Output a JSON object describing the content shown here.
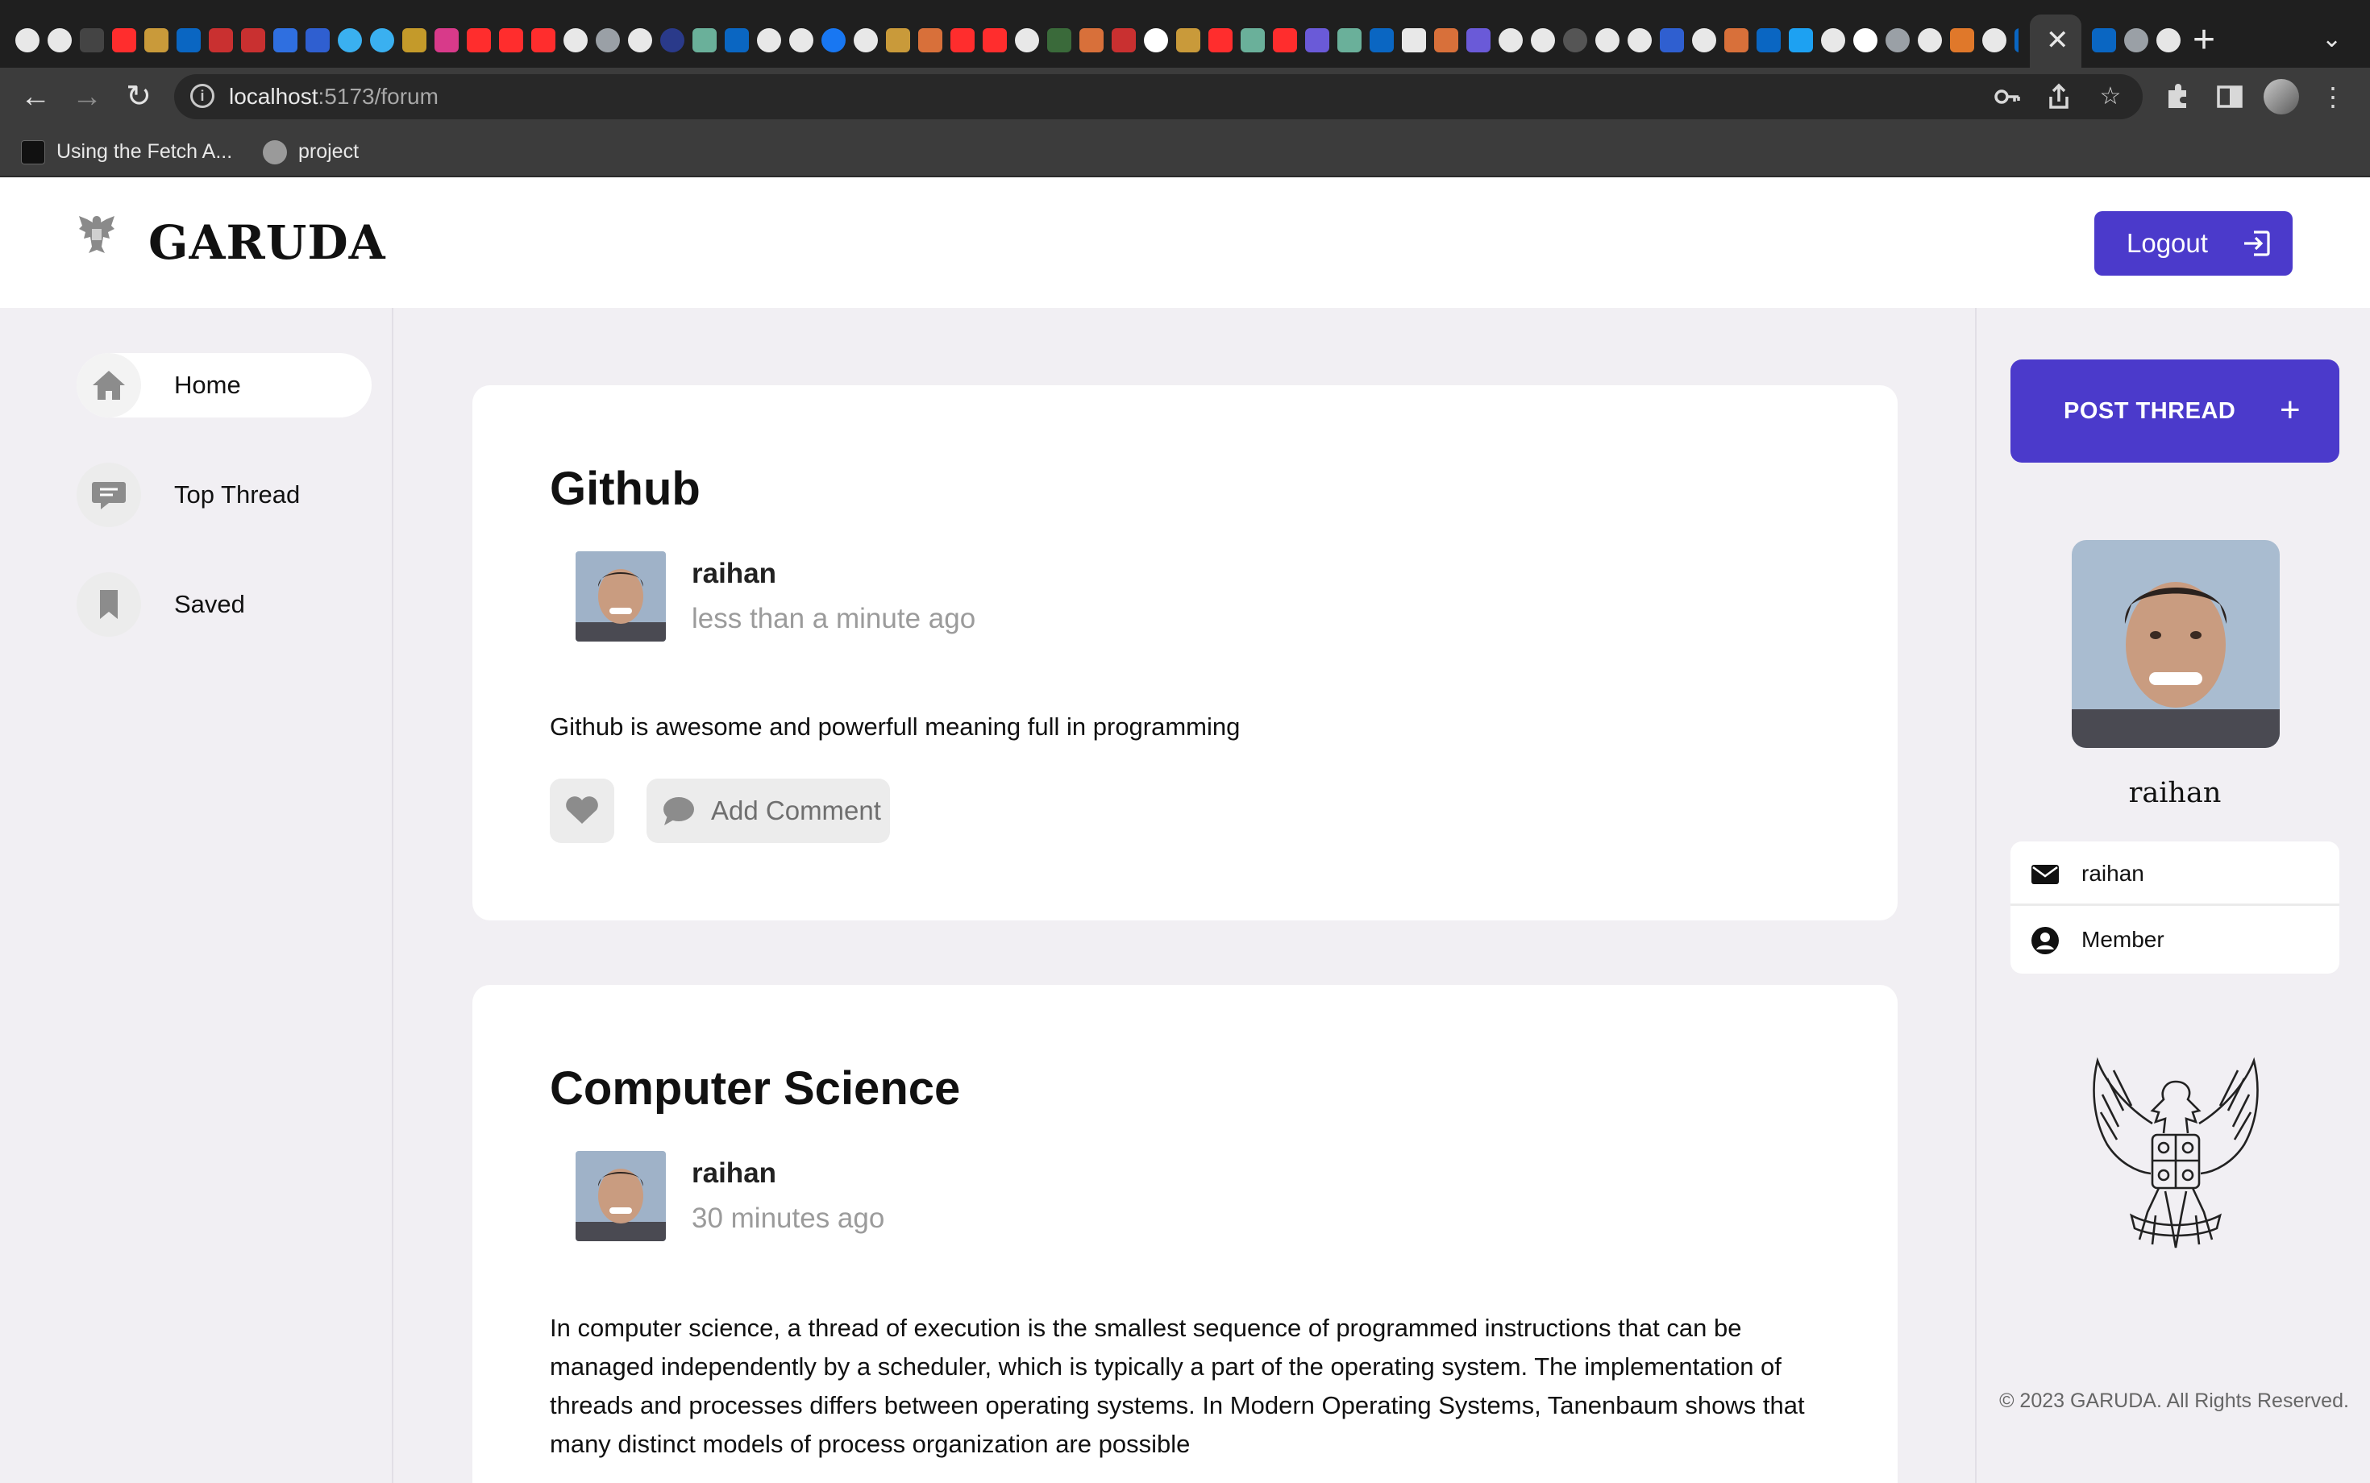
{
  "browser": {
    "url_host": "localhost",
    "url_path": ":5173/forum",
    "bookmarks": [
      {
        "label": "Using the Fetch A...",
        "icon": "mdn-icon"
      },
      {
        "label": "project",
        "icon": "globe-icon"
      }
    ],
    "active_tab_close": "✕",
    "new_tab": "+",
    "tab_menu": "⌄"
  },
  "app": {
    "brand": "GARUDA",
    "logout_label": "Logout"
  },
  "sidebar": {
    "items": [
      {
        "label": "Home",
        "icon": "home-icon",
        "active": true
      },
      {
        "label": "Top Thread",
        "icon": "chat-icon",
        "active": false
      },
      {
        "label": "Saved",
        "icon": "bookmark-icon",
        "active": false
      }
    ]
  },
  "threads": [
    {
      "title": "Github",
      "author": "raihan",
      "time": "less than a minute ago",
      "body": "Github is awesome and powerfull meaning full in programming",
      "comment_label": "Add Comment"
    },
    {
      "title": "Computer Science",
      "author": "raihan",
      "time": "30 minutes ago",
      "body": "In computer science, a thread of execution is the smallest sequence of programmed instructions that can be managed independently by a scheduler, which is typically a part of the operating system. The implementation of threads and processes differs between operating systems. In Modern Operating Systems, Tanenbaum shows that many distinct models of process organization are possible"
    }
  ],
  "profile": {
    "post_thread_label": "POST THREAD",
    "name": "raihan",
    "email": "raihan",
    "role": "Member",
    "copyright": "© 2023 GARUDA. All Rights Reserved."
  },
  "colors": {
    "accent": "#4b3acb",
    "background": "#f1eff3",
    "card": "#ffffff"
  }
}
